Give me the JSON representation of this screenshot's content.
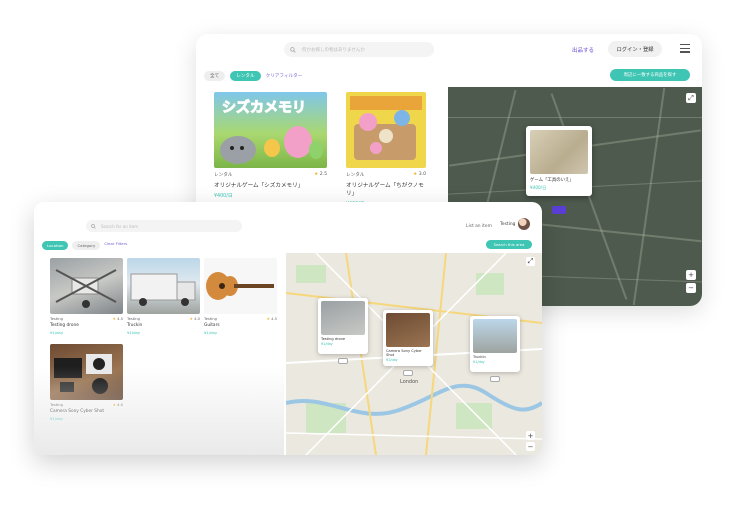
{
  "back_window": {
    "search_placeholder": "何かお探しの物はありませんか",
    "post_link": "出品する",
    "login_button": "ログイン・登録",
    "filters": {
      "all_label": "全て",
      "rental_label": "レンタル",
      "clear_label": "クリアフィルター"
    },
    "map_button_label": "周辺に一致する商品を探す",
    "items": [
      {
        "category": "レンタル",
        "rating": "2.5",
        "title": "オリジナルゲーム「シズカメモリ」",
        "price": "¥400/日"
      },
      {
        "category": "レンタル",
        "rating": "3.0",
        "title": "オリジナルゲーム「ちがクノモリ」",
        "price": "¥400/日"
      }
    ],
    "map_popup": {
      "title": "ゲーム「工具のいえ」",
      "price": "¥400/日"
    }
  },
  "front_window": {
    "search_placeholder": "Search for an item",
    "list_link": "List an item",
    "user_name": "Testing",
    "filters": {
      "location_label": "Location",
      "category_label": "Category",
      "clear_label": "Clear Filters"
    },
    "map_button_label": "Search this area",
    "items": [
      {
        "category": "Testing",
        "rating": "4.5",
        "title": "Testing drone",
        "price": "¥1/day"
      },
      {
        "category": "Testing",
        "rating": "4.0",
        "title": "Truckin",
        "price": "¥1/day"
      },
      {
        "category": "Testing",
        "rating": "4.5",
        "title": "Guitars",
        "price": "¥1/day"
      },
      {
        "category": "Testing",
        "rating": "4.0",
        "title": "Camera Sony Cyber Shot",
        "price": "¥1/day"
      }
    ],
    "map_popups": [
      {
        "title": "Testing drone",
        "price": "¥1/day"
      },
      {
        "title": "Camera Sony Cyber Shot",
        "price": "¥1/day"
      },
      {
        "title": "Truckin",
        "price": "¥1/day"
      }
    ],
    "map_place": "London"
  },
  "colors": {
    "accent": "#3ec5b3",
    "brand_purple": "#6a4fd0",
    "star": "#f3b221"
  },
  "icons": [
    "search-icon",
    "menu-icon",
    "star-icon",
    "fullscreen-icon",
    "zoom-in-icon",
    "zoom-out-icon",
    "avatar"
  ]
}
